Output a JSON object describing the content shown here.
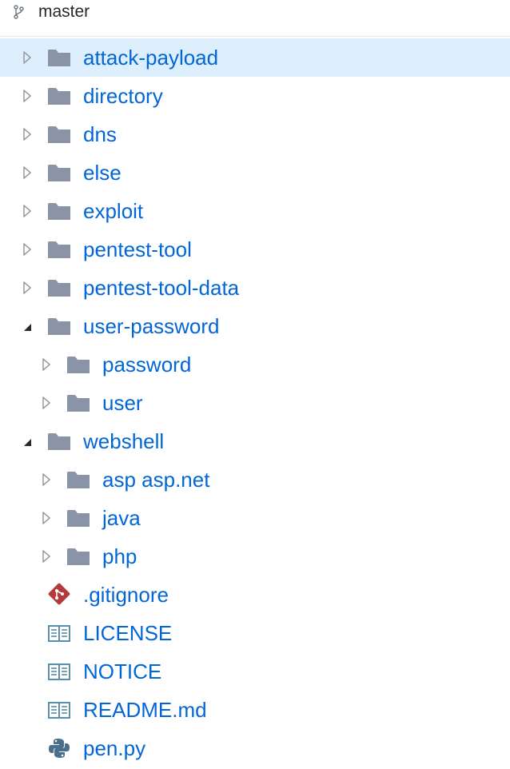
{
  "branch": {
    "name": "master",
    "icon": "git-branch-icon"
  },
  "tree": [
    {
      "id": "attack-payload",
      "label": "attack-payload",
      "type": "folder",
      "depth": 0,
      "expanded": false,
      "selected": true
    },
    {
      "id": "directory",
      "label": "directory",
      "type": "folder",
      "depth": 0,
      "expanded": false
    },
    {
      "id": "dns",
      "label": "dns",
      "type": "folder",
      "depth": 0,
      "expanded": false
    },
    {
      "id": "else",
      "label": "else",
      "type": "folder",
      "depth": 0,
      "expanded": false
    },
    {
      "id": "exploit",
      "label": "exploit",
      "type": "folder",
      "depth": 0,
      "expanded": false
    },
    {
      "id": "pentest-tool",
      "label": "pentest-tool",
      "type": "folder",
      "depth": 0,
      "expanded": false
    },
    {
      "id": "pentest-tool-data",
      "label": "pentest-tool-data",
      "type": "folder",
      "depth": 0,
      "expanded": false
    },
    {
      "id": "user-password",
      "label": "user-password",
      "type": "folder",
      "depth": 0,
      "expanded": true
    },
    {
      "id": "password",
      "label": "password",
      "type": "folder",
      "depth": 1,
      "expanded": false
    },
    {
      "id": "user",
      "label": "user",
      "type": "folder",
      "depth": 1,
      "expanded": false
    },
    {
      "id": "webshell",
      "label": "webshell",
      "type": "folder",
      "depth": 0,
      "expanded": true
    },
    {
      "id": "asp-asp-net",
      "label": "asp asp.net",
      "type": "folder",
      "depth": 1,
      "expanded": false
    },
    {
      "id": "java",
      "label": "java",
      "type": "folder",
      "depth": 1,
      "expanded": false
    },
    {
      "id": "php",
      "label": "php",
      "type": "folder",
      "depth": 1,
      "expanded": false
    },
    {
      "id": "gitignore",
      "label": ".gitignore",
      "type": "file",
      "icon": "git-icon",
      "depth": 0
    },
    {
      "id": "license",
      "label": "LICENSE",
      "type": "file",
      "icon": "book-icon",
      "depth": 0
    },
    {
      "id": "notice",
      "label": "NOTICE",
      "type": "file",
      "icon": "book-icon",
      "depth": 0
    },
    {
      "id": "readme-md",
      "label": "README.md",
      "type": "file",
      "icon": "book-icon",
      "depth": 0
    },
    {
      "id": "pen-py",
      "label": "pen.py",
      "type": "file",
      "icon": "python-icon",
      "depth": 0
    }
  ],
  "colors": {
    "link": "#0366d6",
    "folder": "#8a94a6",
    "selected_row": "#ddeefc",
    "git_icon": "#b33a3a",
    "book_icon": "#5a8fa8",
    "python_icon": "#4a6f8a",
    "toggle": "#9aa0a6"
  }
}
